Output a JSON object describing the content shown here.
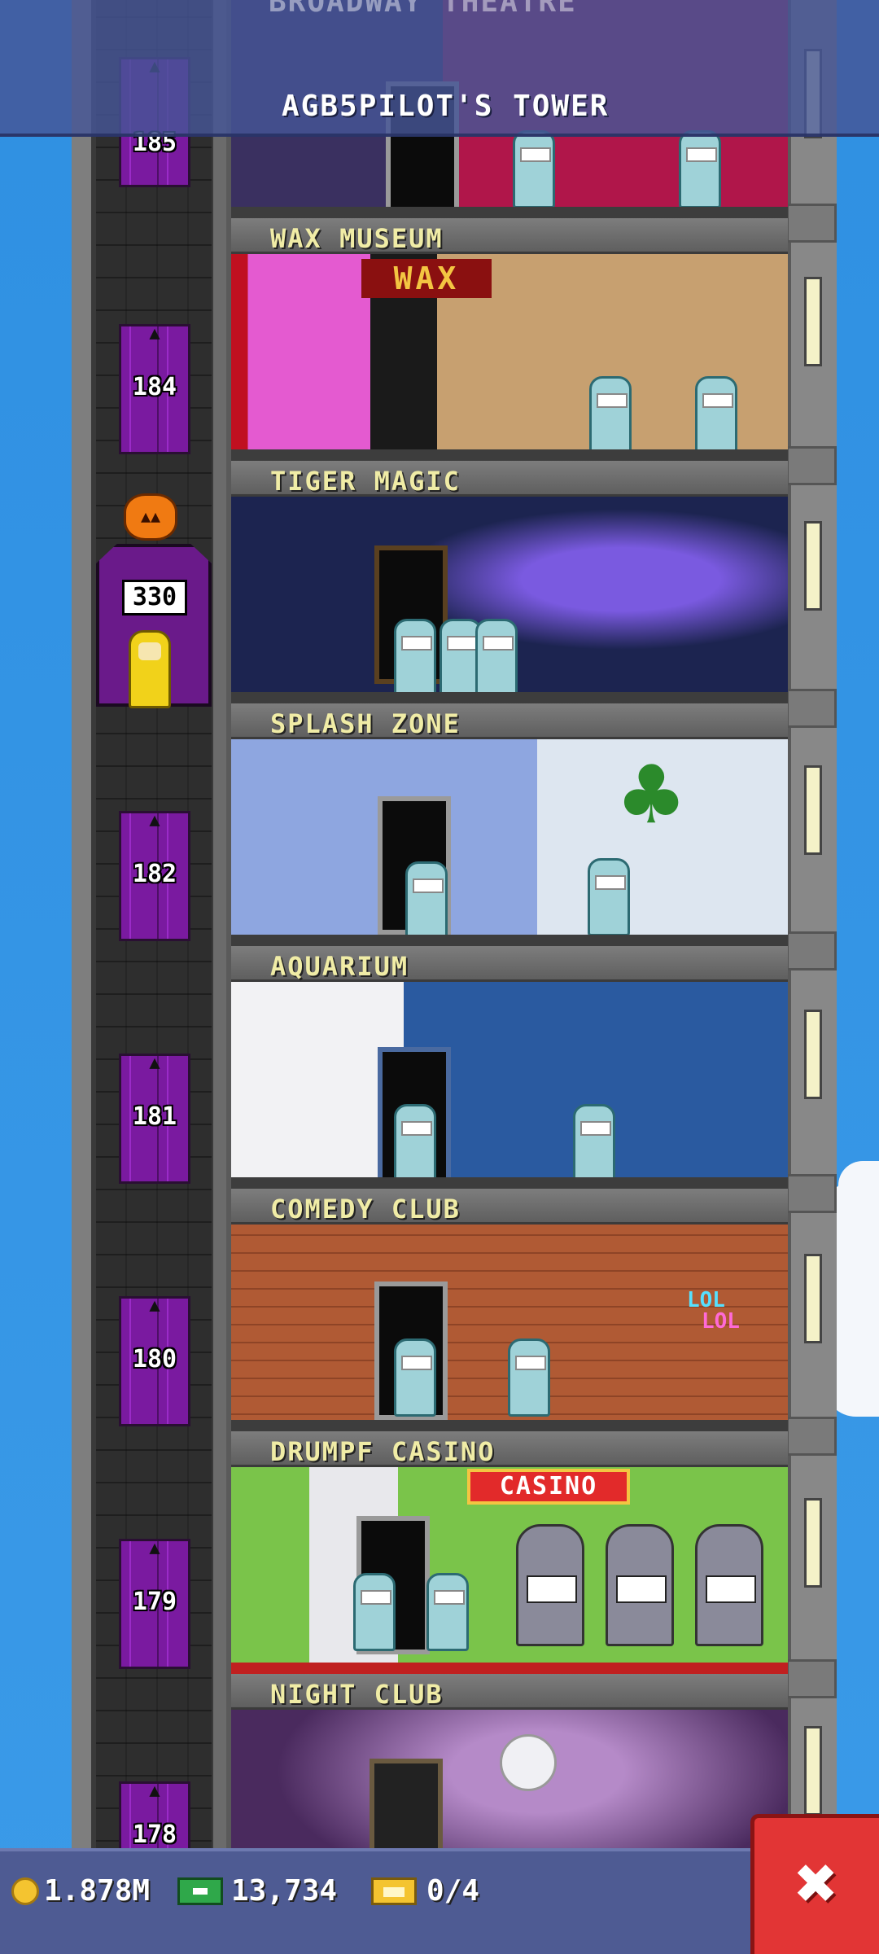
{
  "header": {
    "title": "AGB5PILOT'S TOWER",
    "partial_top_label": "BROADWAY THEATRE"
  },
  "elevator": {
    "display": "330",
    "floor_labels": [
      "185",
      "184",
      "182",
      "181",
      "180",
      "179",
      "178"
    ]
  },
  "floors": [
    {
      "name": "WAX MUSEUM",
      "sign": "WAX"
    },
    {
      "name": "TIGER MAGIC"
    },
    {
      "name": "SPLASH ZONE"
    },
    {
      "name": "AQUARIUM"
    },
    {
      "name": "COMEDY CLUB",
      "sign": "LOL",
      "sign2": "LOL"
    },
    {
      "name": "DRUMPF CASINO",
      "sign": "CASINO"
    },
    {
      "name": "NIGHT CLUB"
    }
  ],
  "bottom_bar": {
    "coins": "1.878M",
    "bux": "13,734",
    "tickets": "0/4",
    "close_label": "✖"
  },
  "colors": {
    "sky": "#2f90e2",
    "elevator_door": "#7a1aa0",
    "floor_label": "#f0eca6",
    "close_button": "#e23535",
    "bottom_bar": "#4e5b93"
  }
}
